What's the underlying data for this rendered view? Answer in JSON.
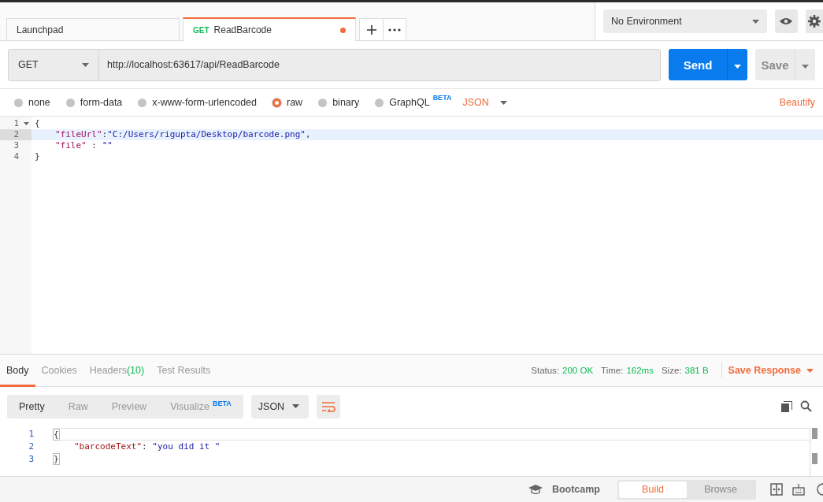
{
  "tabs": [
    {
      "label": "Launchpad",
      "selected": false,
      "unsaved": false
    },
    {
      "method": "GET",
      "label": "ReadBarcode",
      "selected": true,
      "unsaved": true
    }
  ],
  "environment": {
    "value": "No Environment"
  },
  "request": {
    "method": "GET",
    "url": "http://localhost:63617/api/ReadBarcode",
    "send": "Send",
    "save": "Save"
  },
  "body_types": [
    {
      "label": "none",
      "selected": false
    },
    {
      "label": "form-data",
      "selected": false
    },
    {
      "label": "x-www-form-urlencoded",
      "selected": false
    },
    {
      "label": "raw",
      "selected": true
    },
    {
      "label": "binary",
      "selected": false
    },
    {
      "label": "GraphQL",
      "selected": false,
      "badge": "BETA"
    }
  ],
  "body_format": "JSON",
  "beautify": "Beautify",
  "editor": {
    "lines": [
      {
        "number": "1",
        "foldable": true,
        "current": false,
        "indented": false,
        "tokens": [
          {
            "kind": "punct",
            "text": "{"
          }
        ]
      },
      {
        "number": "2",
        "current": true,
        "indented": true,
        "tokens": [
          {
            "kind": "key",
            "text": "\"fileUrl\""
          },
          {
            "kind": "punct",
            "text": ":"
          },
          {
            "kind": "string",
            "text": "\"C:/Users/rigupta/Desktop/barcode.png\""
          },
          {
            "kind": "punct",
            "text": ","
          }
        ]
      },
      {
        "number": "3",
        "current": false,
        "indented": true,
        "tokens": [
          {
            "kind": "key",
            "text": "\"file\""
          },
          {
            "kind": "punct",
            "text": " : "
          },
          {
            "kind": "string",
            "text": "\"\""
          }
        ]
      },
      {
        "number": "4",
        "current": false,
        "indented": false,
        "tokens": [
          {
            "kind": "punct",
            "text": "}"
          }
        ]
      }
    ]
  },
  "response": {
    "tabs": [
      {
        "label": "Body",
        "selected": true
      },
      {
        "label": "Cookies",
        "selected": false
      },
      {
        "label": "Headers",
        "count": "(10)",
        "selected": false
      },
      {
        "label": "Test Results",
        "selected": false
      }
    ],
    "stats": [
      {
        "label": "Status:",
        "value": "200 OK"
      },
      {
        "label": "Time:",
        "value": "162ms"
      },
      {
        "label": "Size:",
        "value": "381 B"
      }
    ],
    "save_response": "Save Response",
    "view_modes": [
      {
        "label": "Pretty",
        "selected": true
      },
      {
        "label": "Raw",
        "selected": false
      },
      {
        "label": "Preview",
        "selected": false
      },
      {
        "label": "Visualize",
        "badge": "BETA",
        "selected": false
      }
    ],
    "format": "JSON",
    "lines": [
      {
        "number": "1",
        "indented": false,
        "tokens": [
          {
            "kind": "bracket",
            "text": "{"
          }
        ]
      },
      {
        "number": "2",
        "indented": true,
        "tokens": [
          {
            "kind": "rkey",
            "text": "\"barcodeText\""
          },
          {
            "kind": "punct",
            "text": ": "
          },
          {
            "kind": "string",
            "text": "\"you did it \""
          }
        ]
      },
      {
        "number": "3",
        "indented": false,
        "tokens": [
          {
            "kind": "bracket",
            "text": "}"
          }
        ]
      }
    ]
  },
  "footer": {
    "bootcamp": "Bootcamp",
    "modes": [
      {
        "label": "Build",
        "selected": true
      },
      {
        "label": "Browse",
        "selected": false
      }
    ]
  }
}
